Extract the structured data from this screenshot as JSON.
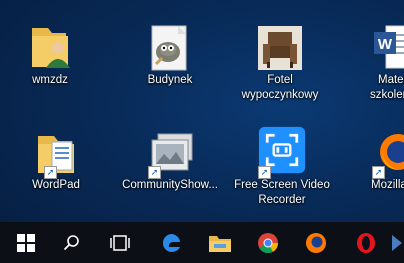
{
  "desktop": {
    "icons": [
      {
        "label": "wmzdz"
      },
      {
        "label": "Budynek"
      },
      {
        "label": "Fotel\nwypoczynkowy"
      },
      {
        "label": "Materi\nszkolenio"
      },
      {
        "label": "WordPad"
      },
      {
        "label": "CommunityShow..."
      },
      {
        "label": "Free Screen Video\nRecorder"
      },
      {
        "label": "Mozilla F"
      }
    ]
  },
  "taskbar": {
    "items": [
      "start",
      "search",
      "task-view",
      "edge",
      "file-explorer",
      "chrome",
      "firefox",
      "opera",
      "more"
    ]
  },
  "colors": {
    "taskbar": "#0d0f17",
    "wallpaper": "#082a57",
    "recorder_blue": "#1e90ff"
  }
}
